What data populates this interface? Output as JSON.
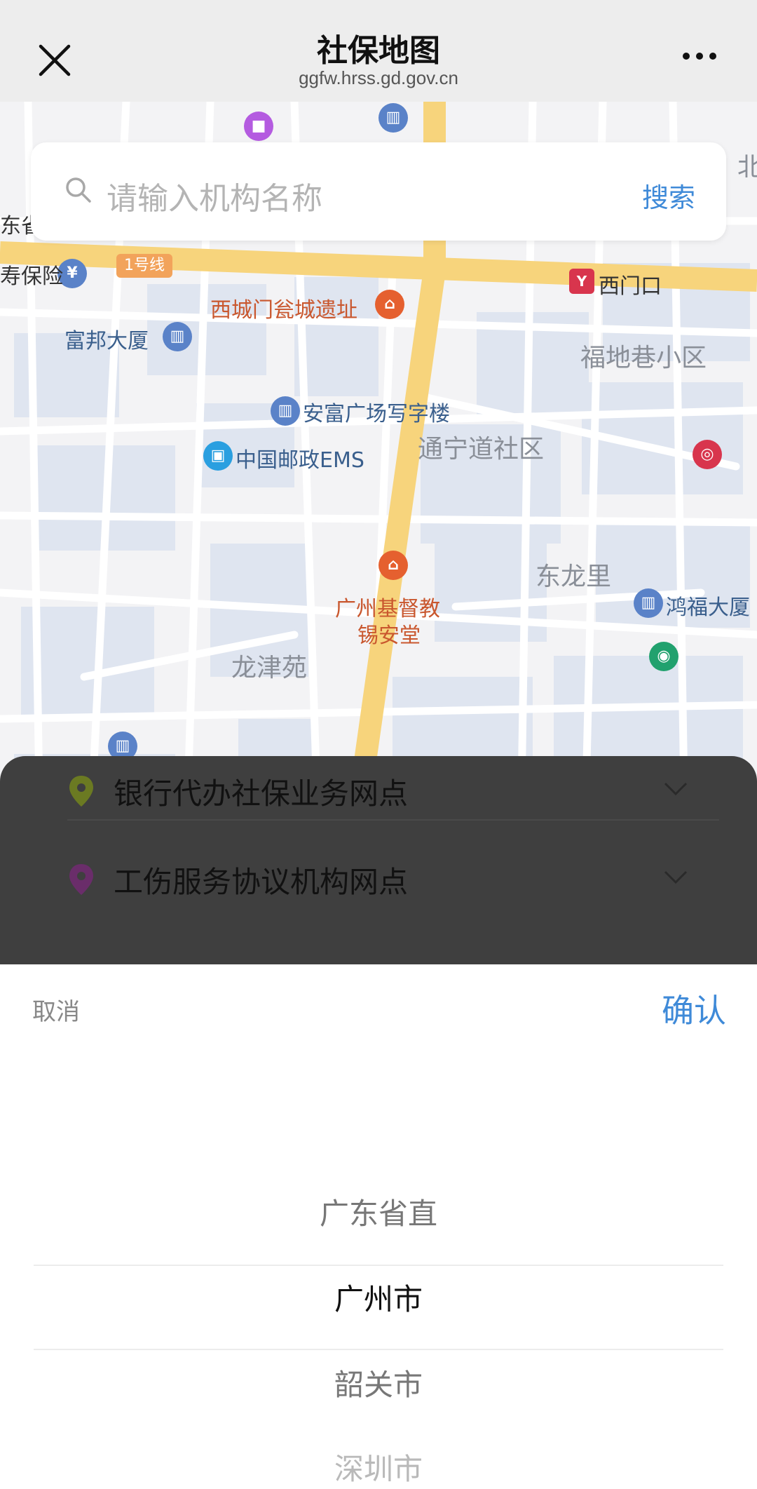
{
  "header": {
    "title": "社保地图",
    "url": "ggfw.hrss.gd.gov.cn"
  },
  "search": {
    "placeholder": "请输入机构名称",
    "button": "搜索"
  },
  "map": {
    "metro_line": "1号线",
    "labels": {
      "a": "东省",
      "b": "寿保险",
      "c": "西城门瓮城遗址",
      "d": "西门口",
      "e": "富邦大厦",
      "f": "福地巷小区",
      "g": "安富广场写字楼",
      "h": "通宁道社区",
      "i": "中国邮政EMS",
      "j": "东龙里",
      "k": "鸿福大厦",
      "l": "广州基督教",
      "m": "锡安堂",
      "n": "龙津苑",
      "o": "北"
    }
  },
  "categories": [
    {
      "label": "银行代办社保业务网点",
      "color": "#8fa52a"
    },
    {
      "label": "工伤服务协议机构网点",
      "color": "#8e3b8e"
    }
  ],
  "picker": {
    "cancel": "取消",
    "confirm": "确认",
    "options": [
      "广东省直",
      "广州市",
      "韶关市",
      "深圳市"
    ],
    "selected": "广州市"
  },
  "colors": {
    "accent": "#3f8ad8",
    "main_road": "#f6d27a",
    "block": "#dde3ef"
  }
}
